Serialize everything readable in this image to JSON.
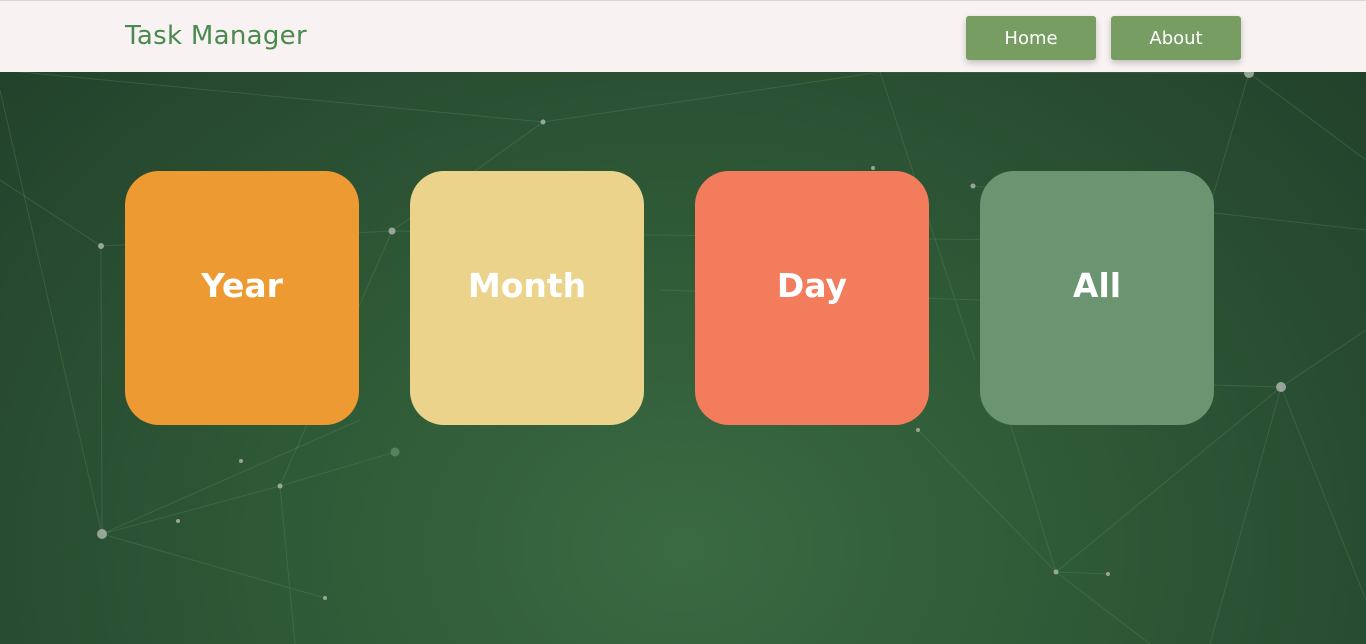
{
  "header": {
    "brand": "Task Manager",
    "nav": [
      {
        "label": "Home"
      },
      {
        "label": "About"
      }
    ]
  },
  "tiles": [
    {
      "label": "Year",
      "color": "#ec9a31"
    },
    {
      "label": "Month",
      "color": "#ebd38c"
    },
    {
      "label": "Day",
      "color": "#f27c5b"
    },
    {
      "label": "All",
      "color": "#6b9570"
    }
  ],
  "theme": {
    "background": "#2f5a37",
    "topbar": "#f8f3f2",
    "brand_color": "#4a8a4e",
    "button_color": "#779d62"
  },
  "background_decoration": "particle-network"
}
